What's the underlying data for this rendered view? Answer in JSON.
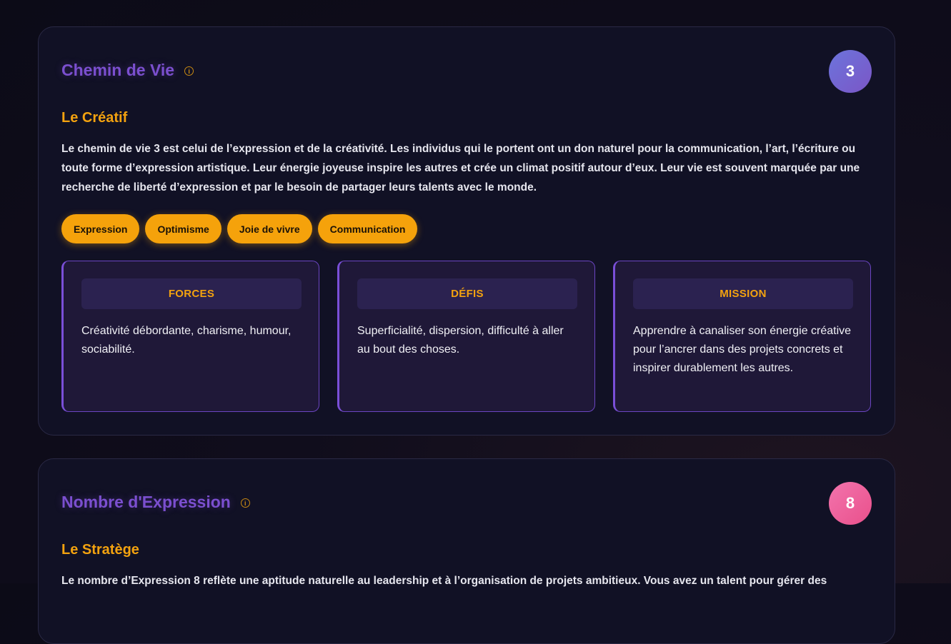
{
  "cards": [
    {
      "title": "Chemin de Vie",
      "number": "3",
      "subtitle": "Le Créatif",
      "description": "Le chemin de vie 3 est celui de l’expression et de la créativité. Les individus qui le portent ont un don naturel pour la communication, l’art, l’écriture ou toute forme d’expression artistique. Leur énergie joyeuse inspire les autres et crée un climat positif autour d’eux. Leur vie est souvent marquée par une recherche de liberté d’expression et par le besoin de partager leurs talents avec le monde.",
      "tags": [
        "Expression",
        "Optimisme",
        "Joie de vivre",
        "Communication"
      ],
      "panels": [
        {
          "heading": "FORCES",
          "text": "Créativité débordante, charisme, humour, sociabilité."
        },
        {
          "heading": "DÉFIS",
          "text": "Superficialité, dispersion, difficulté à aller au bout des choses."
        },
        {
          "heading": "MISSION",
          "text": "Apprendre à canaliser son énergie créative pour l’ancrer dans des projets concrets et inspirer durablement les autres."
        }
      ]
    },
    {
      "title": "Nombre d'Expression",
      "number": "8",
      "subtitle": "Le Stratège",
      "description": "Le nombre d’Expression 8 reflète une aptitude naturelle au leadership et à l’organisation de projets ambitieux. Vous avez un talent pour gérer des"
    }
  ],
  "info_icon_glyph": "i",
  "colors": {
    "accent_purple": "#7b4fcf",
    "accent_orange": "#f3a20f",
    "badge_purple": "#6c74dc",
    "badge_pink": "#f374ad",
    "background": "#0c0b17"
  }
}
